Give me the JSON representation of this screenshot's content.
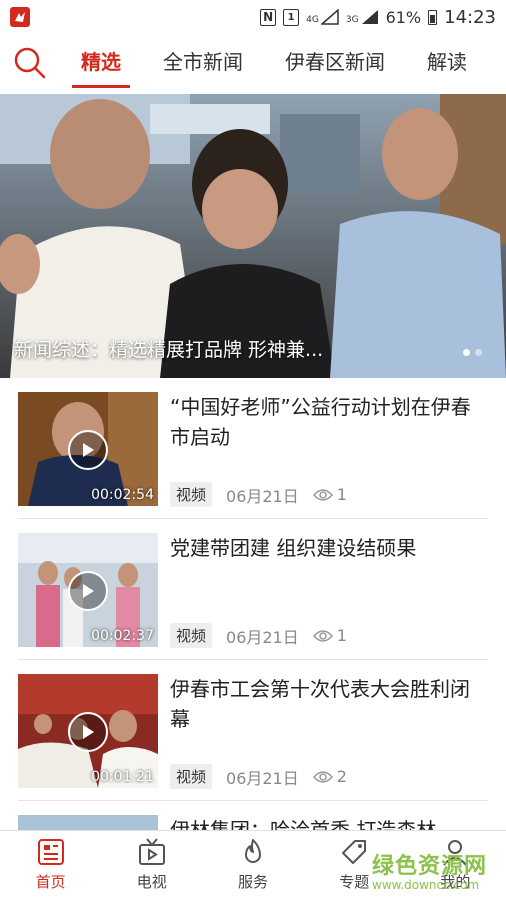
{
  "status_bar": {
    "app_badge": "",
    "icons": [
      "nfc-icon",
      "sim-1-icon",
      "4g-signal-icon",
      "3g-signal-icon",
      "battery-icon"
    ],
    "sim_label": "1",
    "net_4g": "4G",
    "net_3g": "3G",
    "battery": "61%",
    "time": "14:23"
  },
  "tabs": [
    {
      "label": "精选",
      "active": true
    },
    {
      "label": "全市新闻",
      "active": false
    },
    {
      "label": "伊春区新闻",
      "active": false
    },
    {
      "label": "解读",
      "active": false
    }
  ],
  "hero": {
    "caption": "新闻综述：精选精展打品牌 形神兼...",
    "slides": 2,
    "current_slide": 1
  },
  "news": [
    {
      "title": "“中国好老师”公益行动计划在伊春市启动",
      "duration": "00:02:54",
      "tag": "视频",
      "date": "06月21日",
      "views": "1"
    },
    {
      "title": "党建带团建  组织建设结硕果",
      "duration": "00:02:37",
      "tag": "视频",
      "date": "06月21日",
      "views": "1"
    },
    {
      "title": "伊春市工会第十次代表大会胜利闭幕",
      "duration": "00:01:21",
      "tag": "视频",
      "date": "06月21日",
      "views": "2"
    },
    {
      "title": "伊林集团：哈洽首秀 打造森林",
      "duration": "",
      "tag": "",
      "date": "",
      "views": ""
    }
  ],
  "bottom_nav": [
    {
      "label": "首页",
      "icon": "home-news-icon",
      "active": true
    },
    {
      "label": "电视",
      "icon": "tv-icon",
      "active": false
    },
    {
      "label": "服务",
      "icon": "flame-service-icon",
      "active": false
    },
    {
      "label": "专题",
      "icon": "tag-topic-icon",
      "active": false
    },
    {
      "label": "我的",
      "icon": "user-icon",
      "active": false
    }
  ],
  "watermark": {
    "main": "绿色资源网",
    "sub": "www.downcc.com"
  },
  "colors": {
    "accent": "#d42a1e",
    "text": "#222222",
    "muted": "#888888",
    "watermark": "#8bc34a"
  }
}
